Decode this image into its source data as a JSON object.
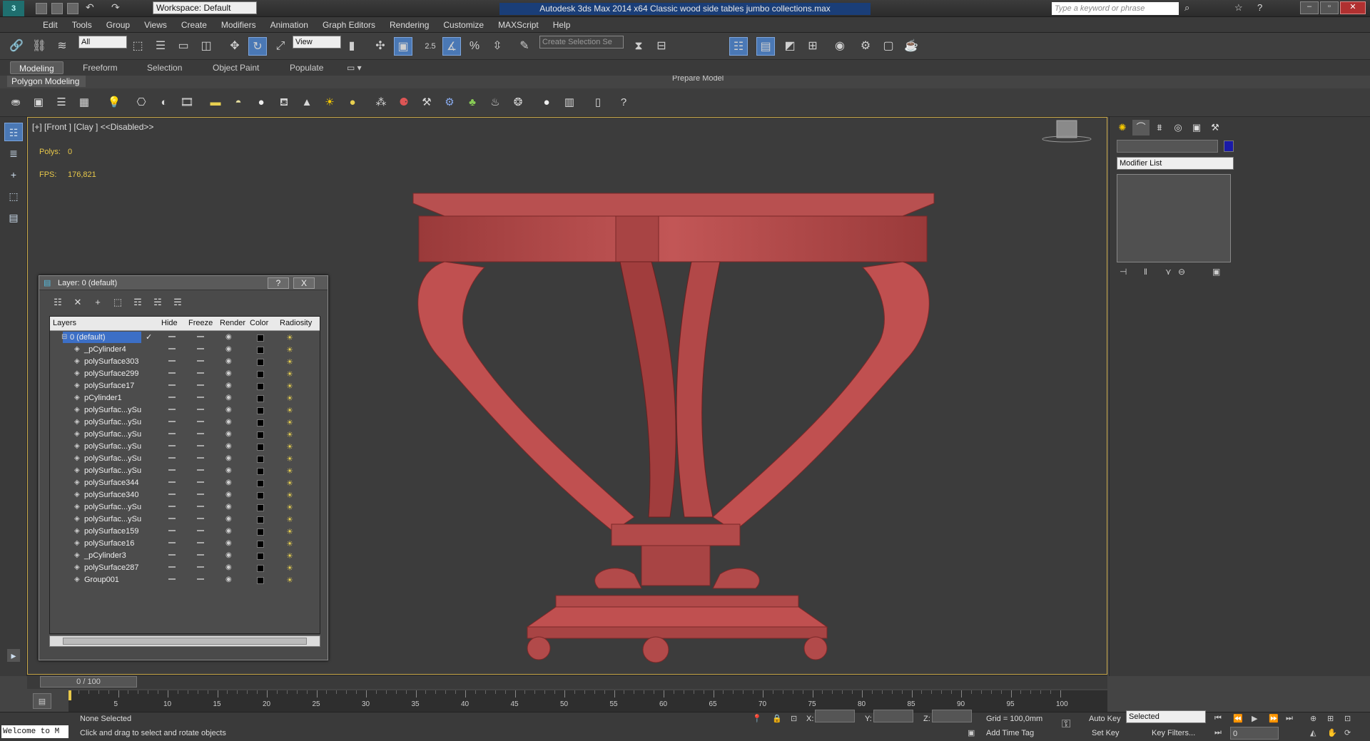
{
  "app": {
    "title": "Autodesk 3ds Max  2014 x64       Classic wood side tables  jumbo collections.max",
    "workspace": "Workspace: Default",
    "search_placeholder": "Type a keyword or phrase"
  },
  "menu": [
    "Edit",
    "Tools",
    "Group",
    "Views",
    "Create",
    "Modifiers",
    "Animation",
    "Graph Editors",
    "Rendering",
    "Customize",
    "MAXScript",
    "Help"
  ],
  "toolbar": {
    "selection_filter": "All",
    "ref_coord": "View",
    "snap_value": "2.5",
    "named_selection": "Create Selection Se",
    "prepare_model": "Prepare Model"
  },
  "ribbon": {
    "tabs": [
      "Modeling",
      "Freeform",
      "Selection",
      "Object Paint",
      "Populate"
    ],
    "active_tab": "Modeling",
    "sub_label": "Polygon Modeling"
  },
  "viewport": {
    "label": "[+] [Front ] [Clay ]  <<Disabled>>",
    "polys_label": "Polys:",
    "polys_value": "0",
    "fps_label": "FPS:",
    "fps_value": "176,821",
    "model_color": "#b84a4a"
  },
  "command_panel": {
    "modifier_list": "Modifier List",
    "color_swatch": "#1a1aa8"
  },
  "layer_dialog": {
    "title": "Layer: 0 (default)",
    "help_btn": "?",
    "close_btn": "X",
    "columns": [
      "Layers",
      "Hide",
      "Freeze",
      "Render",
      "Color",
      "Radiosity"
    ],
    "root_layer": "0 (default)",
    "rows": [
      "_pCylinder4",
      "polySurface303",
      "polySurface299",
      "polySurface17",
      "pCylinder1",
      "polySurfac...ySu",
      "polySurfac...ySu",
      "polySurfac...ySu",
      "polySurfac...ySu",
      "polySurfac...ySu",
      "polySurfac...ySu",
      "polySurface344",
      "polySurface340",
      "polySurfac...ySu",
      "polySurfac...ySu",
      "polySurface159",
      "polySurface16",
      "_pCylinder3",
      "polySurface287",
      "Group001"
    ]
  },
  "timeline": {
    "frame_display": "0 / 100",
    "ticks": [
      "5",
      "10",
      "15",
      "20",
      "25",
      "30",
      "35",
      "40",
      "45",
      "50",
      "55",
      "60",
      "65",
      "70",
      "75",
      "80",
      "85",
      "90",
      "95",
      "100"
    ]
  },
  "status": {
    "welcome": "Welcome to M",
    "selection": "None Selected",
    "prompt": "Click and drag to select and rotate objects",
    "x_label": "X:",
    "y_label": "Y:",
    "z_label": "Z:",
    "grid": "Grid = 100,0mm",
    "add_time_tag": "Add Time Tag",
    "auto_key": "Auto Key",
    "set_key": "Set Key",
    "key_mode": "Selected",
    "key_filters": "Key Filters...",
    "frame": "0"
  }
}
